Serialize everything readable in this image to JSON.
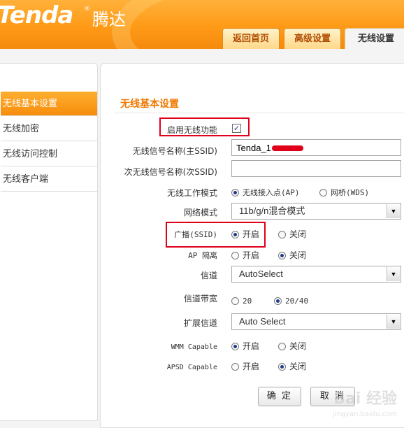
{
  "brand": {
    "logo_text": "Tenda",
    "logo_reg": "®",
    "logo_cn": "腾达"
  },
  "tabs": [
    {
      "label": "返回首页"
    },
    {
      "label": "高级设置"
    },
    {
      "label": "无线设置",
      "active": true
    }
  ],
  "sidebar": {
    "items": [
      {
        "label": "无线基本设置",
        "active": true
      },
      {
        "label": "无线加密"
      },
      {
        "label": "无线访问控制"
      },
      {
        "label": "无线客户端"
      }
    ]
  },
  "form": {
    "section_title": "无线基本设置",
    "enable_wireless": {
      "label": "启用无线功能",
      "checked": true,
      "mark": "✓"
    },
    "ssid_primary": {
      "label": "无线信号名称(主SSID)",
      "value": "Tenda_1"
    },
    "ssid_secondary": {
      "label": "次无线信号名称(次SSID)",
      "value": ""
    },
    "work_mode": {
      "label": "无线工作模式",
      "options": [
        "无线接入点(AP)",
        "网桥(WDS)"
      ],
      "selected": 0
    },
    "network_mode": {
      "label": "网络模式",
      "value": "11b/g/n混合模式"
    },
    "broadcast": {
      "label": "广播(SSID)",
      "options": [
        "开启",
        "关闭"
      ],
      "selected": 0
    },
    "ap_isolation": {
      "label": "AP 隔离",
      "options": [
        "开启",
        "关闭"
      ],
      "selected": 1
    },
    "channel": {
      "label": "信道",
      "value": "AutoSelect"
    },
    "bandwidth": {
      "label": "信道带宽",
      "options": [
        "20",
        "20/40"
      ],
      "selected": 1
    },
    "ext_channel": {
      "label": "扩展信道",
      "value": "Auto Select"
    },
    "wmm": {
      "label": "WMM Capable",
      "options": [
        "开启",
        "关闭"
      ],
      "selected": 0
    },
    "apsd": {
      "label": "APSD Capable",
      "options": [
        "开启",
        "关闭"
      ],
      "selected": 1
    },
    "buttons": {
      "ok": "确 定",
      "cancel": "取 消"
    }
  },
  "watermark": {
    "text": "Bai 经验",
    "sub": "jingyan.baidu.com"
  },
  "colors": {
    "accent": "#f78d0d",
    "highlight": "#e0001a",
    "title": "#f07800"
  },
  "icons": {
    "select_arrow": "▼",
    "check": "✓"
  }
}
